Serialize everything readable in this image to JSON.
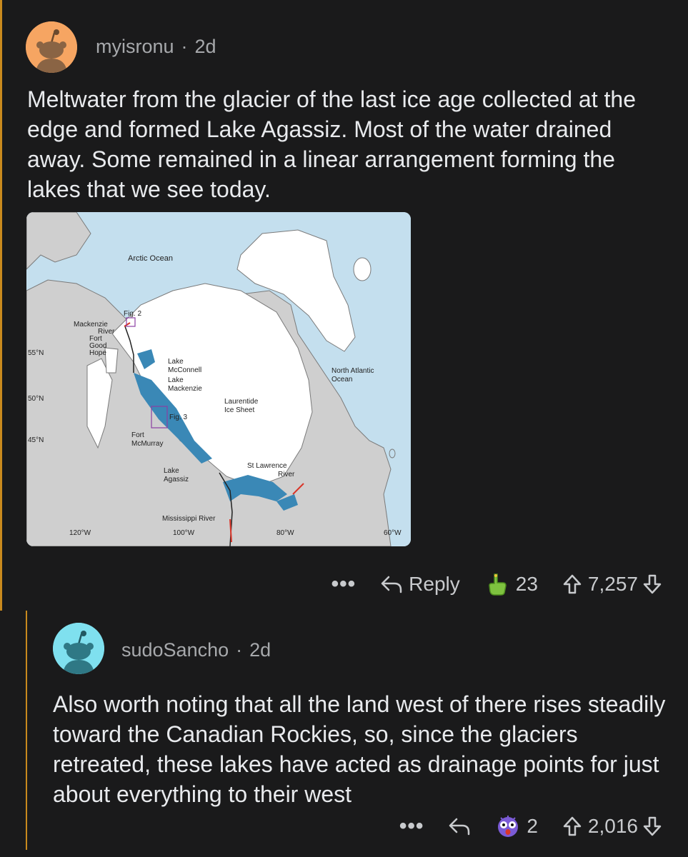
{
  "comments": [
    {
      "username": "myisronu",
      "time": "2d",
      "body": "Meltwater from the glacier of the last ice age collected at the edge and formed Lake Agassiz.  Most of the water drained away. Some remained in a linear arrangement forming the lakes that we see today.",
      "image": {
        "labels": {
          "arctic": "Arctic Ocean",
          "fig2": "Fig. 2",
          "mackenzie_river_1": "Mackenzie",
          "mackenzie_river_2": "River",
          "fort_good_hope_1": "Fort",
          "fort_good_hope_2": "Good",
          "fort_good_hope_3": "Hope",
          "lake_mcconnell_1": "Lake",
          "lake_mcconnell_2": "McConnell",
          "lake_mackenzie_1": "Lake",
          "lake_mackenzie_2": "Mackenzie",
          "laurentide_1": "Laurentide",
          "laurentide_2": "Ice Sheet",
          "fig3": "Fig. 3",
          "fort_mcmurray_1": "Fort",
          "fort_mcmurray_2": "McMurray",
          "lake_agassiz_1": "Lake",
          "lake_agassiz_2": "Agassiz",
          "st_lawrence_1": "St Lawrence",
          "st_lawrence_2": "River",
          "north_atlantic_1": "North Atlantic",
          "north_atlantic_2": "Ocean",
          "mississippi": "Mississippi River",
          "lat55": "55°N",
          "lat50": "50°N",
          "lat45": "45°N",
          "lon120": "120°W",
          "lon100": "100°W",
          "lon80": "80°W",
          "lon60": "60°W"
        }
      },
      "actions": {
        "more": "•••",
        "reply": "Reply",
        "award_count": "23",
        "score": "7,257"
      }
    },
    {
      "username": "sudoSancho",
      "time": "2d",
      "body": "Also worth noting that all the land west of there rises steadily toward the Canadian Rockies, so, since the glaciers retreated, these lakes have acted as drainage points for just about everything to their west",
      "actions": {
        "more": "•••",
        "award_count": "2",
        "score": "2,016"
      }
    }
  ],
  "colors": {
    "background": "#1a1a1b",
    "thread_line": "#c98a1e",
    "avatar1": "#f6a562",
    "avatar2": "#7fe0ef",
    "ocean": "#c4dfee",
    "land": "#cfcfcf",
    "ice": "#ffffff",
    "lake": "#3a88b6"
  }
}
